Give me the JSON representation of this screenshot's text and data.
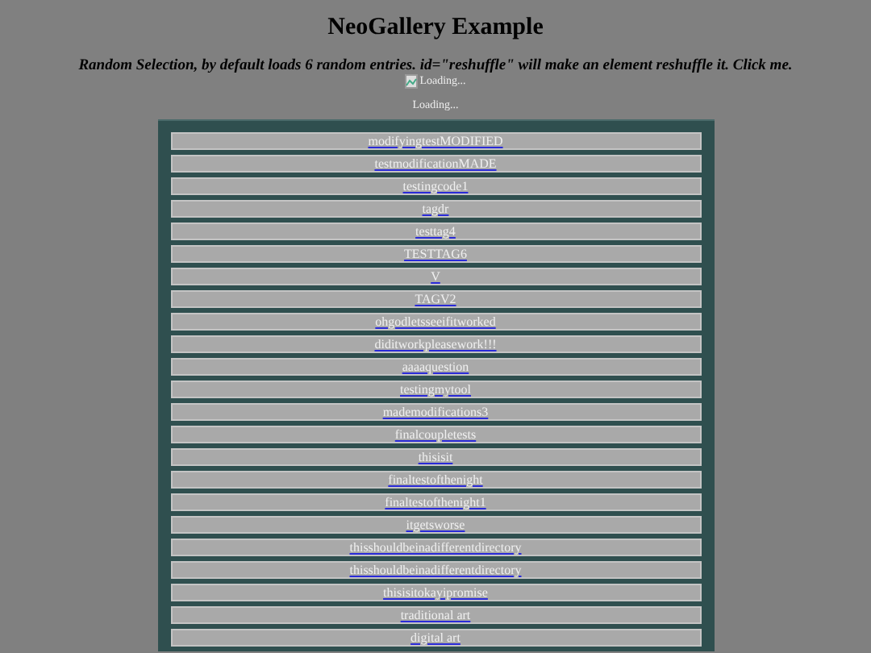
{
  "title": "NeoGallery Example",
  "subtitle": "Random Selection, by default loads 6 random entries. id=\"reshuffle\" will make an element reshuffle it. Click me.",
  "image_alt": "Loading...",
  "status": "Loading...",
  "entries": [
    "modifyingtestMODIFIED",
    "testmodificationMADE",
    "testingcode1",
    "tagdr",
    "testtag4",
    "TESTTAG6",
    "V",
    "TAGV2",
    "ohgodletsseeifitworked",
    "diditworkpleasework!!!",
    "aaaaquestion",
    "testingmytool",
    "mademodifications3",
    "finalcoupletests",
    "thisisit",
    "finaltestofthenight",
    "finaltestofthenight1",
    "itgetsworse",
    "thisshouldbeinadifferentdirectory",
    "thisshouldbeinadifferentdirectory",
    "thisisitokayipromise",
    "traditional art",
    "digital art"
  ]
}
